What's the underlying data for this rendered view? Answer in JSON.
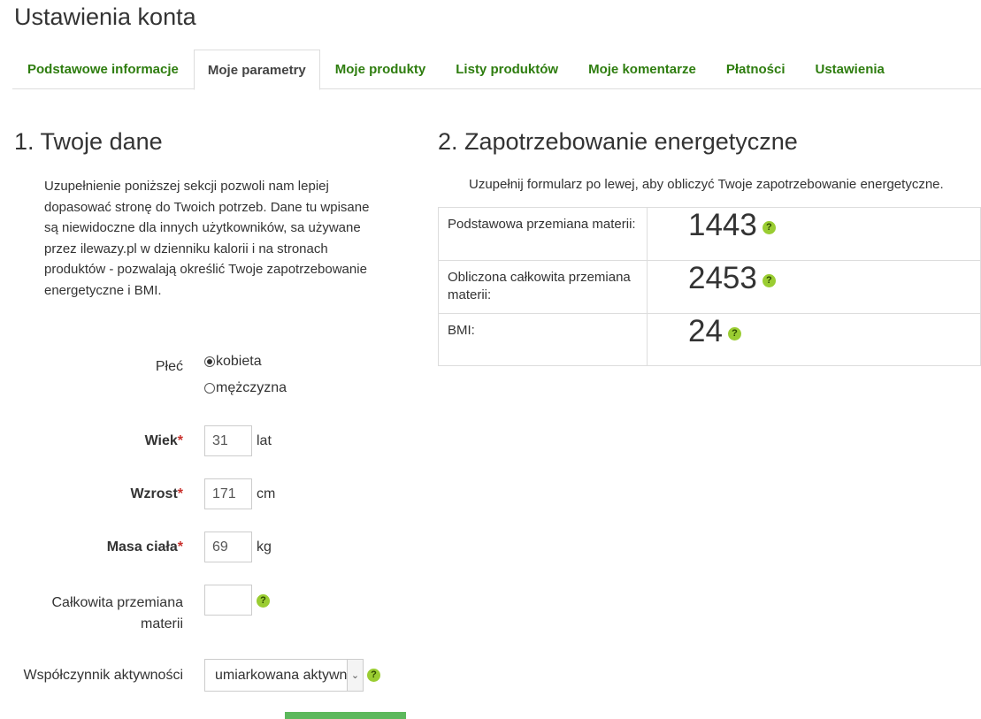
{
  "page": {
    "title": "Ustawienia konta"
  },
  "tabs": [
    {
      "label": "Podstawowe informacje",
      "active": false
    },
    {
      "label": "Moje parametry",
      "active": true
    },
    {
      "label": "Moje produkty",
      "active": false
    },
    {
      "label": "Listy produktów",
      "active": false
    },
    {
      "label": "Moje komentarze",
      "active": false
    },
    {
      "label": "Płatności",
      "active": false
    },
    {
      "label": "Ustawienia",
      "active": false
    }
  ],
  "left": {
    "heading": "1. Twoje dane",
    "intro": "Uzupełnienie poniższej sekcji pozwoli nam lepiej dopasować stronę do Twoich potrzeb. Dane tu wpisane są niewidoczne dla innych użytkowników, sa używane przez ilewazy.pl w dzienniku kalorii i na stronach produktów - pozwalają określić Twoje zapotrzebowanie energetyczne i BMI.",
    "sex": {
      "label": "Płeć",
      "options": [
        "kobieta",
        "mężczyzna"
      ],
      "selected": "kobieta"
    },
    "age": {
      "label": "Wiek",
      "required_mark": "*",
      "value": "31",
      "unit": "lat"
    },
    "height": {
      "label": "Wzrost",
      "required_mark": "*",
      "value": "171",
      "unit": "cm"
    },
    "weight": {
      "label": "Masa ciała",
      "required_mark": "*",
      "value": "69",
      "unit": "kg"
    },
    "total_metabolism": {
      "label_line1": "Całkowita przemiana",
      "label_line2": "materii",
      "value": ""
    },
    "activity": {
      "label": "Współczynnik aktywności",
      "selected": "umiarkowana aktywność"
    },
    "help_glyph": "?"
  },
  "right": {
    "heading": "2. Zapotrzebowanie energetyczne",
    "intro": "Uzupełnij formularz po lewej, aby obliczyć Twoje zapotrzebowanie energetyczne.",
    "rows": [
      {
        "label": "Podstawowa przemiana materii:",
        "value": "1443"
      },
      {
        "label": "Obliczona całkowita przemiana materii:",
        "value": "2453"
      },
      {
        "label": "BMI:",
        "value": "24"
      }
    ]
  },
  "colors": {
    "link_green": "#2e7d0f",
    "help_green": "#9acd32",
    "required_red": "#c9302c",
    "button_green": "#5cb85c"
  }
}
